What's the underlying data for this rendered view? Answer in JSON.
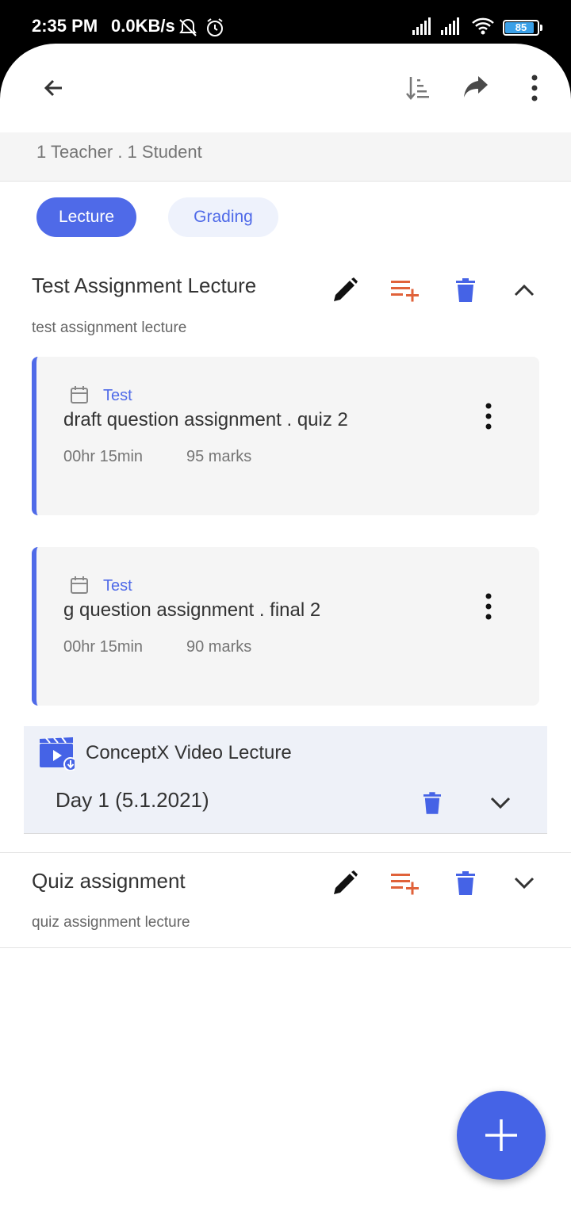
{
  "status_bar": {
    "time": "2:35 PM",
    "speed": "0.0KB/s",
    "battery": "85",
    "battery_level": 0.85
  },
  "toolbar": {
    "back_icon": "arrow-left-icon",
    "sort_icon": "sort-icon",
    "share_icon": "share-icon",
    "more_icon": "more-vertical-icon"
  },
  "subheader": {
    "members": "1 Teacher . 1 Student"
  },
  "tabs": [
    {
      "label": "Lecture",
      "active": true
    },
    {
      "label": "Grading",
      "active": false
    }
  ],
  "sections": [
    {
      "title": "Test Assignment Lecture",
      "subtitle": "test assignment lecture",
      "expanded": true,
      "items": [
        {
          "tag": "Test",
          "title": "draft question assignment . quiz 2",
          "duration": "00hr 15min",
          "marks": "95 marks"
        },
        {
          "tag": "Test",
          "title": "g question assignment . final 2",
          "duration": "00hr 15min",
          "marks": "90 marks"
        }
      ],
      "video": {
        "title": "ConceptX Video Lecture",
        "day": "Day 1 (5.1.2021)"
      }
    },
    {
      "title": "Quiz assignment",
      "subtitle": "quiz assignment lecture",
      "expanded": false
    }
  ],
  "colors": {
    "accent": "#4f6ae8",
    "add_icon": "#e0623a",
    "delete_icon": "#4563e6"
  },
  "fab": {
    "icon": "plus-icon"
  }
}
